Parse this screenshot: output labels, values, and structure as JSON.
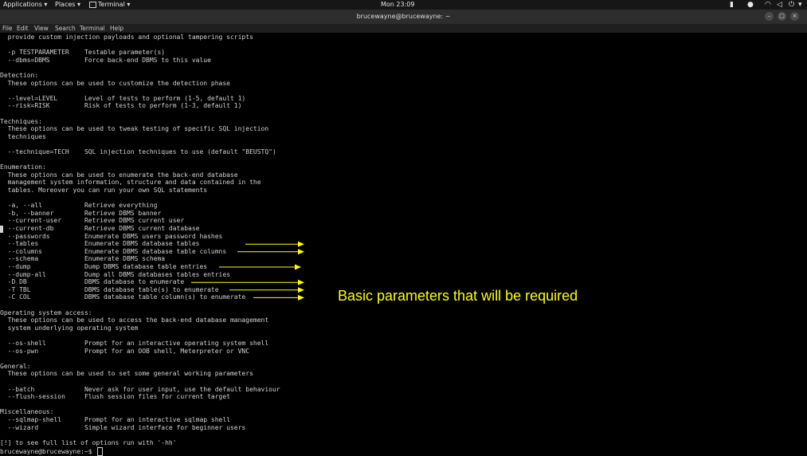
{
  "topbar": {
    "applications": "Applications ▾",
    "places": "Places ▾",
    "terminal": "Terminal ▾",
    "clock": "Mon 23:09"
  },
  "window": {
    "title": "brucewayne@brucewayne: ~"
  },
  "menu": [
    "File",
    "Edit",
    "View",
    "Search",
    "Terminal",
    "Help"
  ],
  "terminal_lines": [
    "  provide custom injection payloads and optional tampering scripts",
    "",
    "  -p TESTPARAMETER    Testable parameter(s)",
    "  --dbms=DBMS         Force back-end DBMS to this value",
    "",
    "Detection:",
    "  These options can be used to customize the detection phase",
    "",
    "  --level=LEVEL       Level of tests to perform (1-5, default 1)",
    "  --risk=RISK         Risk of tests to perform (1-3, default 1)",
    "",
    "Techniques:",
    "  These options can be used to tweak testing of specific SQL injection",
    "  techniques",
    "",
    "  --technique=TECH    SQL injection techniques to use (default \"BEUSTQ\")",
    "",
    "Enumeration:",
    "  These options can be used to enumerate the back-end database",
    "  management system information, structure and data contained in the",
    "  tables. Moreover you can run your own SQL statements",
    "",
    "  -a, --all           Retrieve everything",
    "  -b, --banner        Retrieve DBMS banner",
    "  --current-user      Retrieve DBMS current user",
    "  --current-db        Retrieve DBMS current database",
    "  --passwords         Enumerate DBMS users password hashes",
    "  --tables            Enumerate DBMS database tables",
    "  --columns           Enumerate DBMS database table columns",
    "  --schema            Enumerate DBMS schema",
    "  --dump              Dump DBMS database table entries",
    "  --dump-all          Dump all DBMS databases tables entries",
    "  -D DB               DBMS database to enumerate",
    "  -T TBL              DBMS database table(s) to enumerate",
    "  -C COL              DBMS database table column(s) to enumerate",
    "",
    "Operating system access:",
    "  These options can be used to access the back-end database management",
    "  system underlying operating system",
    "",
    "  --os-shell          Prompt for an interactive operating system shell",
    "  --os-pwn            Prompt for an OOB shell, Meterpreter or VNC",
    "",
    "General:",
    "  These options can be used to set some general working parameters",
    "",
    "  --batch             Never ask for user input, use the default behaviour",
    "  --flush-session     Flush session files for current target",
    "",
    "Miscellaneous:",
    "  --sqlmap-shell      Prompt for an interactive sqlmap shell",
    "  --wizard            Simple wizard interface for beginner users",
    "",
    "[!] to see full list of options run with '-hh'"
  ],
  "prompt": "brucewayne@brucewayne:~$ ",
  "arrow_rows": [
    27,
    28,
    30,
    32,
    33,
    34
  ],
  "annotation": {
    "text": "Basic parameters that will be required",
    "color": "#ffff00"
  }
}
